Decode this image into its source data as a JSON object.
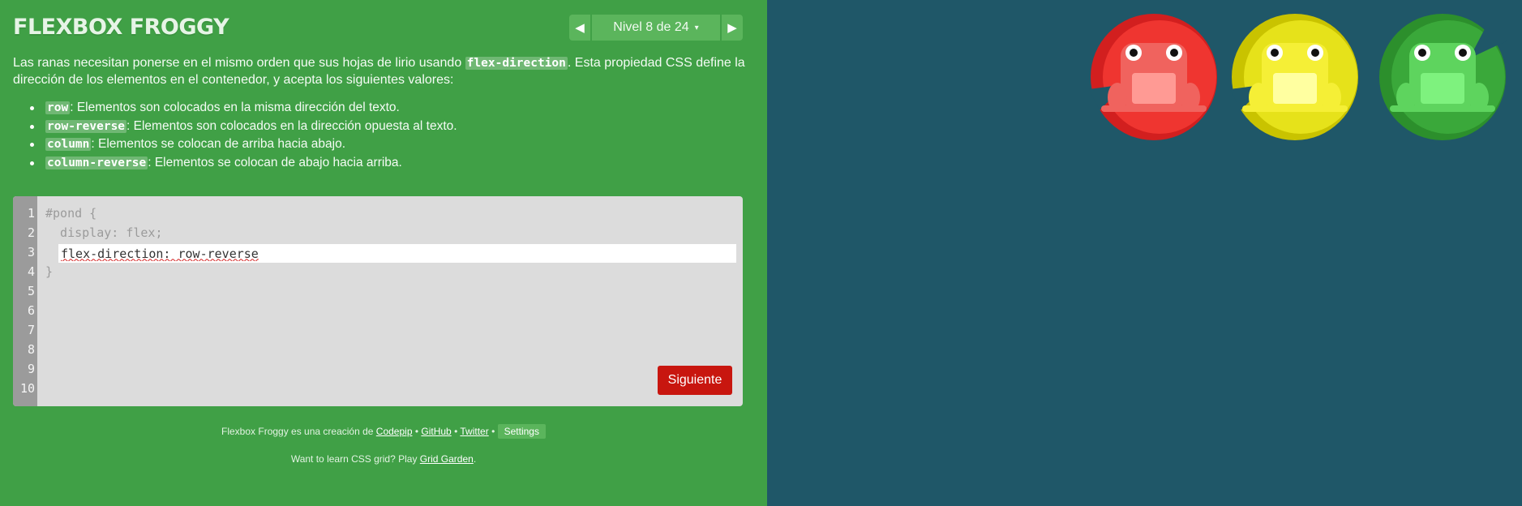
{
  "header": {
    "title": "FLEXBOX FROGGY"
  },
  "level_nav": {
    "prev_icon": "triangle-left-icon",
    "label": "Nivel 8 de 24",
    "caret": "▾",
    "next_icon": "triangle-right-icon"
  },
  "instructions": {
    "text_before": "Las ranas necesitan ponerse en el mismo orden que sus hojas de lirio usando ",
    "property": "flex-direction",
    "text_after": ". Esta propiedad CSS define la dirección de los elementos en el contenedor, y acepta los siguientes valores:",
    "values": [
      {
        "code": "row",
        "desc": ": Elementos son colocados en la misma dirección del texto."
      },
      {
        "code": "row-reverse",
        "desc": ": Elementos son colocados en la dirección opuesta al texto."
      },
      {
        "code": "column",
        "desc": ": Elementos se colocan de arriba hacia abajo."
      },
      {
        "code": "column-reverse",
        "desc": ": Elementos se colocan de abajo hacia arriba."
      }
    ]
  },
  "editor": {
    "line_numbers": [
      "1",
      "2",
      "3",
      "4",
      "5",
      "6",
      "7",
      "8",
      "9",
      "10"
    ],
    "line1": "#pond {",
    "line2": "  display: flex;",
    "input_value": "flex-direction: row-reverse",
    "line4": "}",
    "next_label": "Siguiente"
  },
  "footer": {
    "credit_text": "Flexbox Froggy es una creación de ",
    "codepip": "Codepip",
    "sep1": " • ",
    "github": "GitHub",
    "sep2": " • ",
    "twitter": "Twitter",
    "sep3": " • ",
    "settings": "Settings",
    "promo_text": "Want to learn CSS grid? Play ",
    "grid_garden": "Grid Garden",
    "promo_end": "."
  },
  "pond": {
    "frogs": [
      {
        "color": "red",
        "body": "#f0635e",
        "pad": "#d21f1f",
        "pad_light": "#ef3530",
        "belly": "#ff9a94"
      },
      {
        "color": "yellow",
        "body": "#f5ef36",
        "pad": "#c9c300",
        "pad_light": "#e6e21a",
        "belly": "#ffffa0"
      },
      {
        "color": "green",
        "body": "#5ed45e",
        "pad": "#2c8f2c",
        "pad_light": "#3aa83a",
        "belly": "#7ef27e"
      }
    ],
    "background": "#1f5768"
  }
}
